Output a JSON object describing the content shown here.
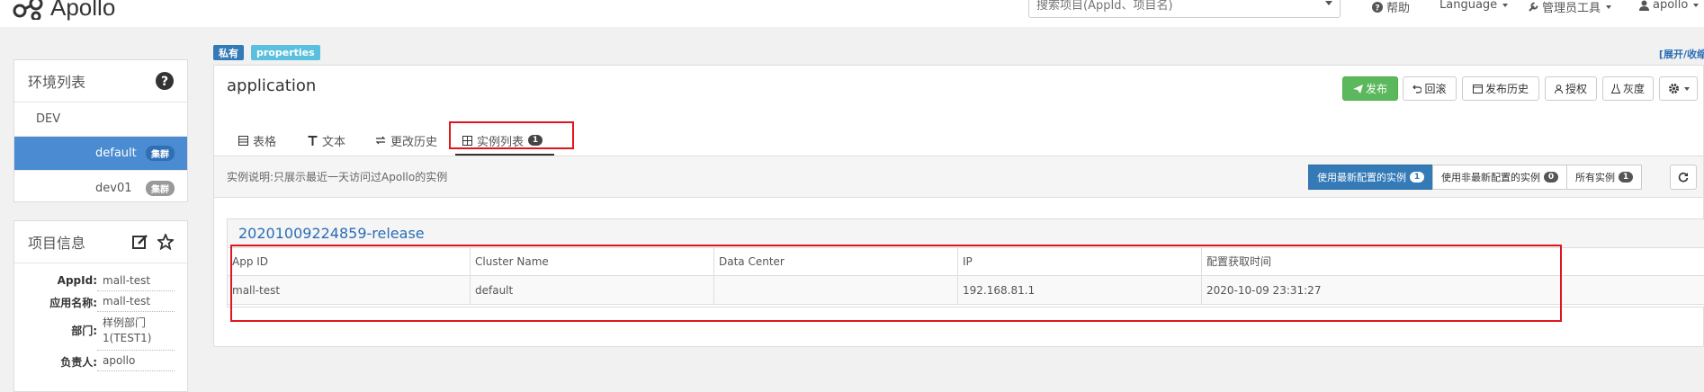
{
  "navbar": {
    "brand": "Apollo",
    "search_placeholder": "搜索项目(AppId、项目名)",
    "help": "帮助",
    "language": "Language",
    "admin_tools": "管理员工具",
    "user": "apollo"
  },
  "env_panel": {
    "title": "环境列表",
    "items": [
      {
        "label": "DEV",
        "badge": ""
      },
      {
        "label": "default",
        "badge": "集群"
      },
      {
        "label": "dev01",
        "badge": "集群"
      }
    ]
  },
  "project_panel": {
    "title": "项目信息",
    "rows": [
      {
        "label": "AppId:",
        "value": "mall-test"
      },
      {
        "label": "应用名称:",
        "value": "mall-test"
      },
      {
        "label": "部门:",
        "value": "样例部门1(TEST1)"
      },
      {
        "label": "负责人:",
        "value": "apollo"
      }
    ]
  },
  "namespace": {
    "tag_private": "私有",
    "tag_format": "properties",
    "expand_link": "[展开/收缩]",
    "title": "application",
    "buttons": {
      "publish": "发布",
      "rollback": "回滚",
      "history": "发布历史",
      "authorize": "授权",
      "gray": "灰度"
    },
    "tabs": {
      "table": "表格",
      "text": "文本",
      "change_history": "更改历史",
      "instances": "实例列表",
      "instances_count": "1"
    }
  },
  "instances": {
    "description": "实例说明:只展示最近一天访问过Apollo的实例",
    "filters": [
      {
        "label": "使用最新配置的实例",
        "count": "1"
      },
      {
        "label": "使用非最新配置的实例",
        "count": "0"
      },
      {
        "label": "所有实例",
        "count": "1"
      }
    ],
    "release_name": "20201009224859-release",
    "columns": [
      "App ID",
      "Cluster Name",
      "Data Center",
      "IP",
      "配置获取时间"
    ],
    "rows": [
      [
        "mall-test",
        "default",
        "",
        "192.168.81.1",
        "2020-10-09 23:31:27"
      ]
    ]
  },
  "colors": {
    "primary": "#337ab7",
    "success": "#5cb85c",
    "highlight": "#e0161d"
  }
}
